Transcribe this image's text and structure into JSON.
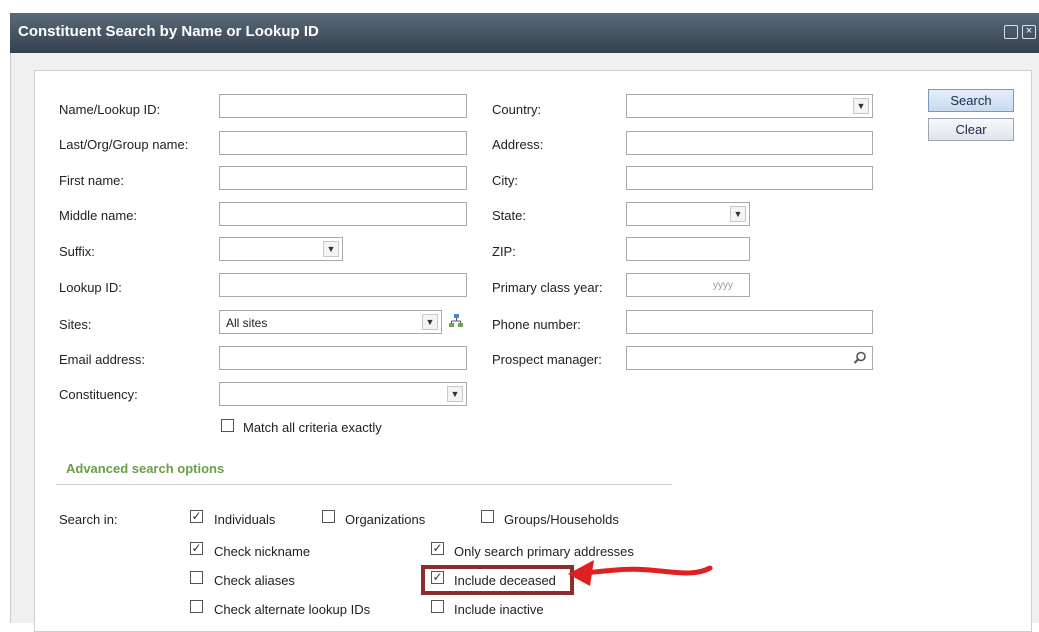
{
  "window": {
    "title": "Constituent Search by Name or Lookup ID"
  },
  "buttons": {
    "search": "Search",
    "clear": "Clear"
  },
  "left_fields": [
    {
      "label": "Name/Lookup ID:",
      "value": ""
    },
    {
      "label": "Last/Org/Group name:",
      "value": ""
    },
    {
      "label": "First name:",
      "value": ""
    },
    {
      "label": "Middle name:",
      "value": ""
    },
    {
      "label": "Suffix:",
      "value": ""
    },
    {
      "label": "Lookup ID:",
      "value": ""
    },
    {
      "label": "Sites:",
      "value": "All sites"
    },
    {
      "label": "Email address:",
      "value": ""
    },
    {
      "label": "Constituency:",
      "value": ""
    }
  ],
  "right_fields": [
    {
      "label": "Country:",
      "value": ""
    },
    {
      "label": "Address:",
      "value": ""
    },
    {
      "label": "City:",
      "value": ""
    },
    {
      "label": "State:",
      "value": ""
    },
    {
      "label": "ZIP:",
      "value": ""
    },
    {
      "label": "Primary class year:",
      "value": "",
      "placeholder": "yyyy"
    },
    {
      "label": "Phone number:",
      "value": ""
    },
    {
      "label": "Prospect manager:",
      "value": ""
    }
  ],
  "match_all": {
    "label": "Match all criteria exactly",
    "checked": false
  },
  "advanced": {
    "title": "Advanced search options",
    "search_in_label": "Search in:",
    "options": [
      {
        "label": "Individuals",
        "checked": true
      },
      {
        "label": "Organizations",
        "checked": false
      },
      {
        "label": "Groups/Households",
        "checked": false
      },
      {
        "label": "Check nickname",
        "checked": true
      },
      {
        "label": "Only search primary addresses",
        "checked": true
      },
      {
        "label": "Check aliases",
        "checked": false
      },
      {
        "label": "Include deceased",
        "checked": true
      },
      {
        "label": "Check alternate lookup IDs",
        "checked": false
      },
      {
        "label": "Include inactive",
        "checked": false
      }
    ]
  },
  "annotation": {
    "arrow_color": "#e02020",
    "highlight_color": "#8b2e2e"
  }
}
